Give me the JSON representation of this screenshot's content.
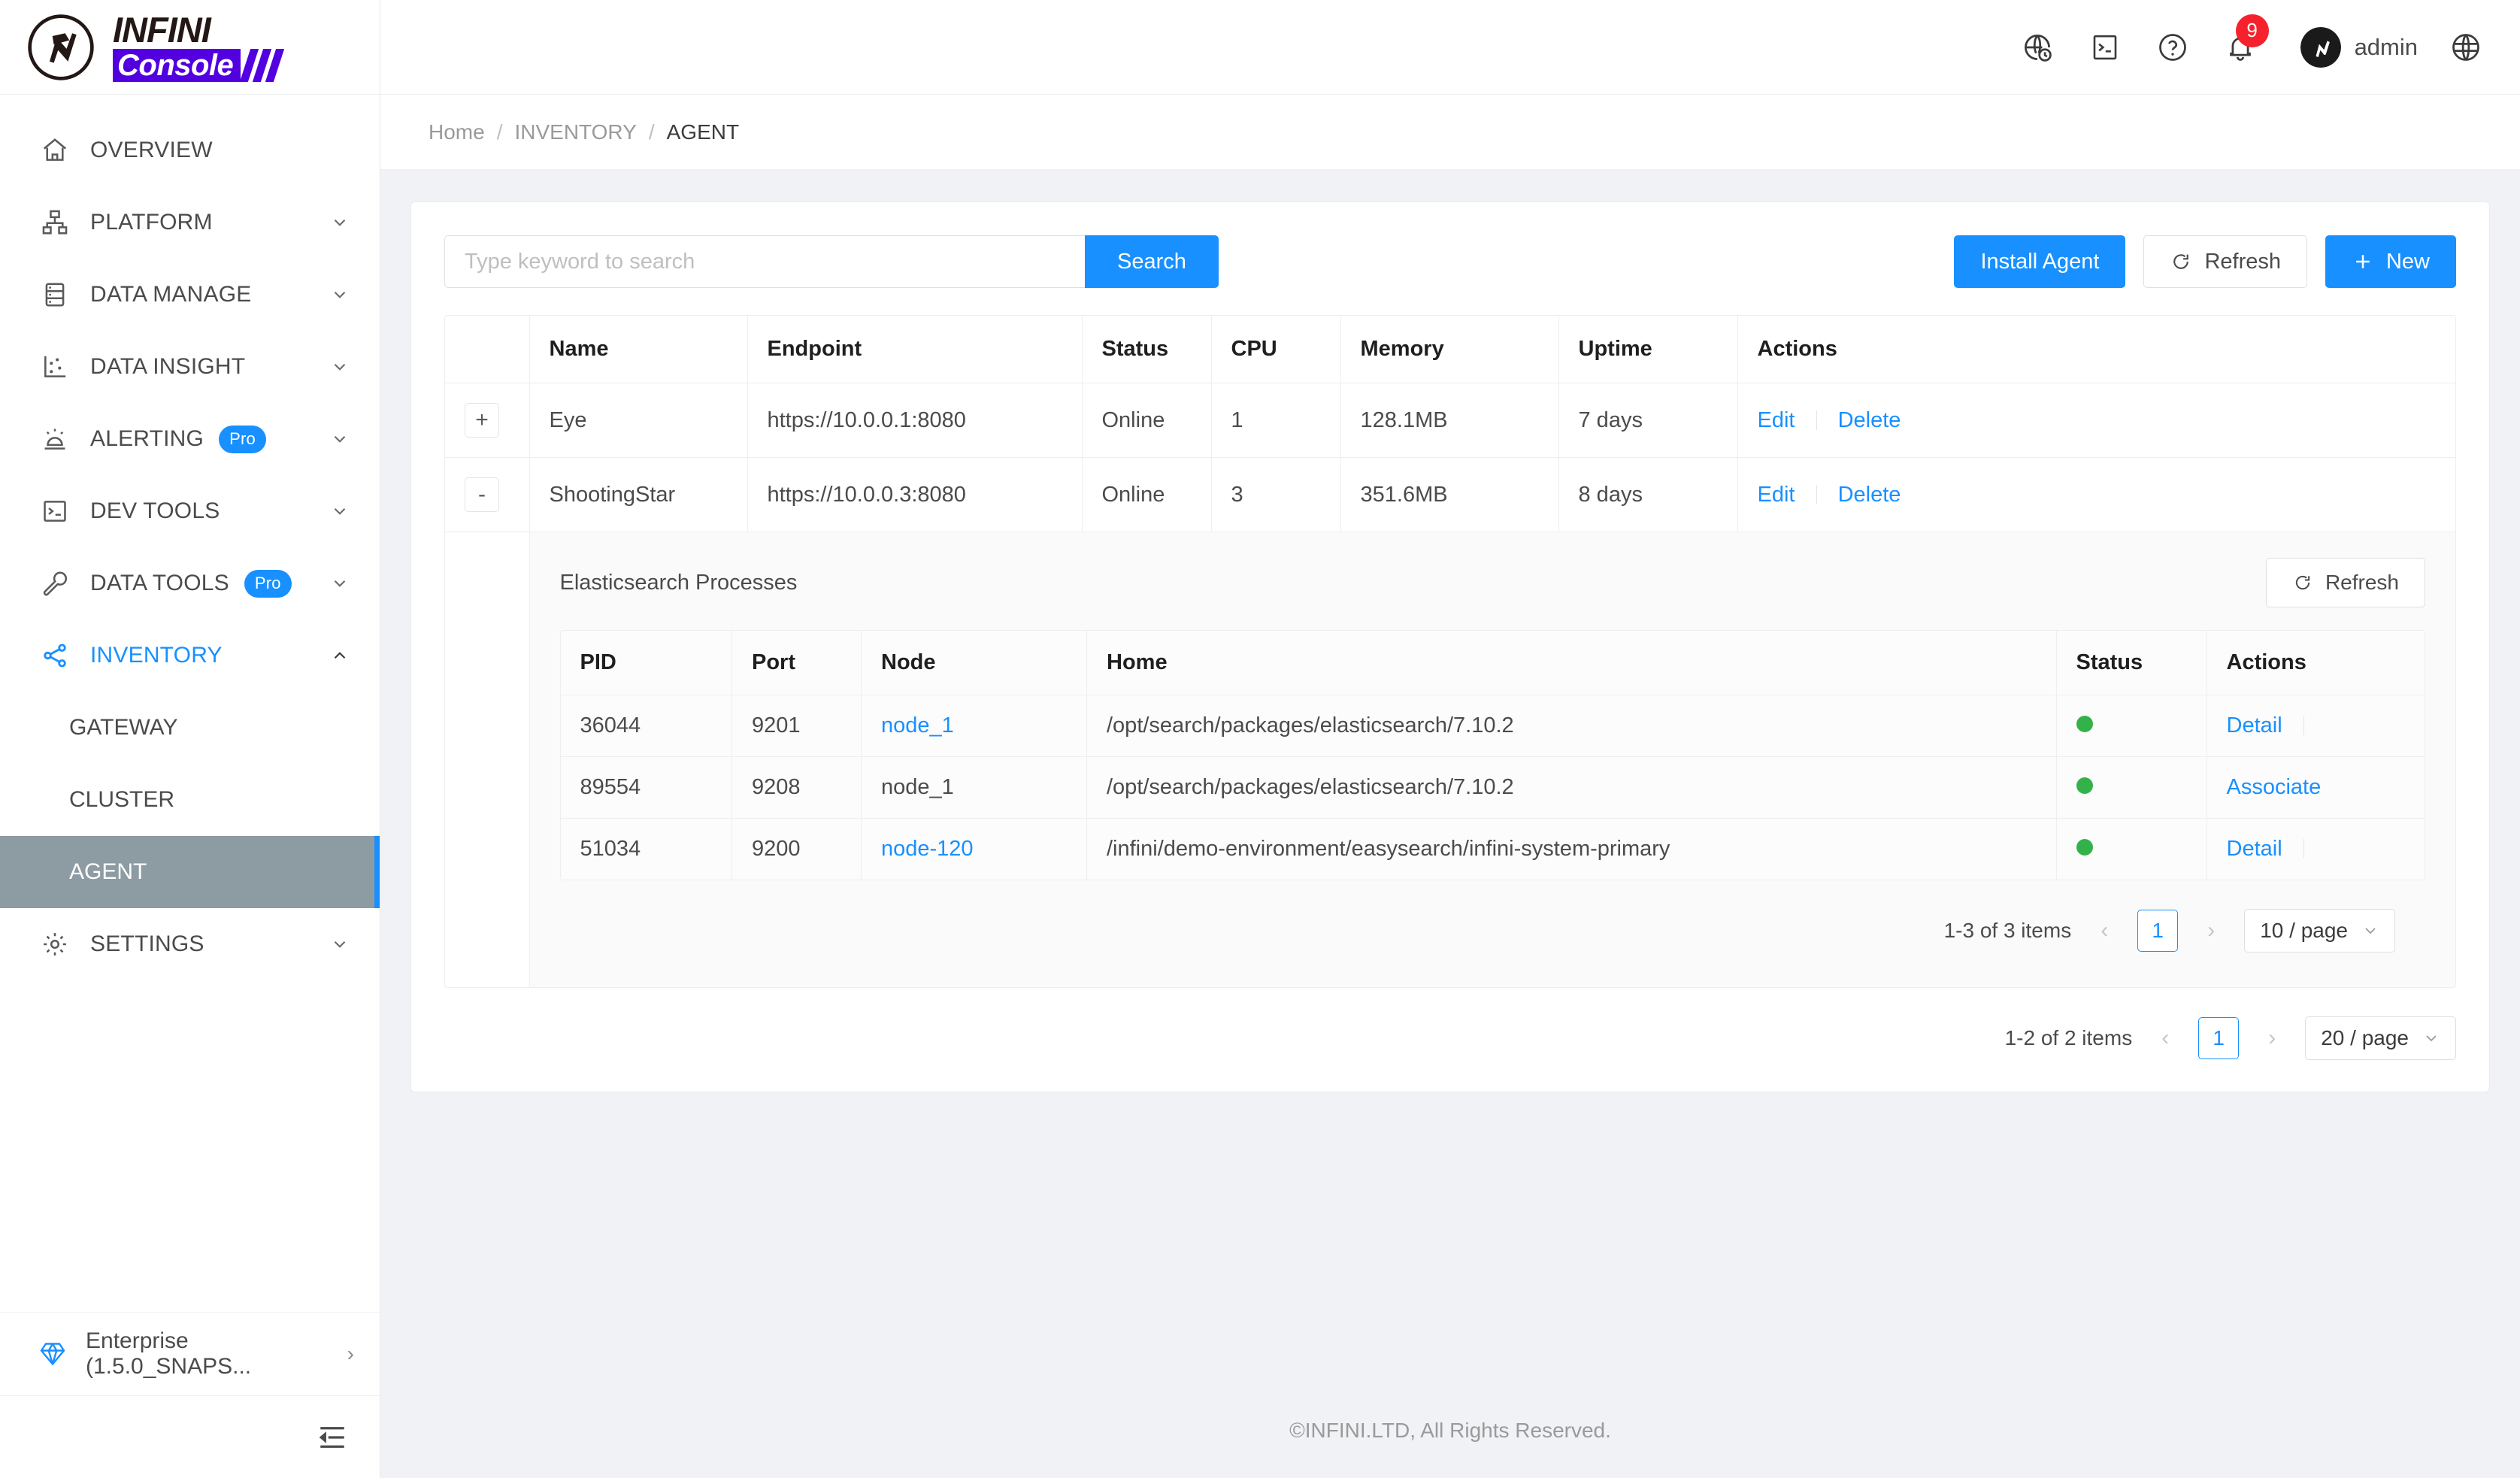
{
  "brand": {
    "line1": "INFINI",
    "line2": "Console"
  },
  "header": {
    "icons": [
      "globe-clock-icon",
      "console-icon",
      "help-icon",
      "bell-icon",
      "language-icon"
    ],
    "notification_count": "9",
    "user": "admin"
  },
  "breadcrumb": {
    "items": [
      "Home",
      "INVENTORY",
      "AGENT"
    ],
    "separator": "/"
  },
  "sidebar": {
    "items": [
      {
        "label": "OVERVIEW",
        "icon": "home-icon",
        "chevron": "",
        "badge": ""
      },
      {
        "label": "PLATFORM",
        "icon": "platform-icon",
        "chevron": "down",
        "badge": ""
      },
      {
        "label": "DATA MANAGE",
        "icon": "database-icon",
        "chevron": "down",
        "badge": ""
      },
      {
        "label": "DATA INSIGHT",
        "icon": "chart-icon",
        "chevron": "down",
        "badge": ""
      },
      {
        "label": "ALERTING",
        "icon": "alarm-icon",
        "chevron": "down",
        "badge": "Pro"
      },
      {
        "label": "DEV TOOLS",
        "icon": "terminal-icon",
        "chevron": "down",
        "badge": ""
      },
      {
        "label": "DATA TOOLS",
        "icon": "wrench-icon",
        "chevron": "down",
        "badge": "Pro"
      },
      {
        "label": "INVENTORY",
        "icon": "share-icon",
        "chevron": "up",
        "badge": ""
      }
    ],
    "inventory_children": [
      "GATEWAY",
      "CLUSTER",
      "AGENT"
    ],
    "selected_child": "AGENT",
    "settings": {
      "label": "SETTINGS",
      "icon": "gear-icon",
      "chevron": "down"
    },
    "license": {
      "label": "Enterprise (1.5.0_SNAPS...",
      "icon": "diamond-icon",
      "arrow": "›"
    },
    "collapse_icon": "collapse-menu-icon"
  },
  "toolbar": {
    "search_placeholder": "Type keyword to search",
    "search_value": "",
    "search_label": "Search",
    "install_agent_label": "Install Agent",
    "refresh_label": "Refresh",
    "new_label": "New",
    "new_icon": "plus-icon",
    "refresh_icon": "refresh-icon"
  },
  "agents_table": {
    "columns": [
      "",
      "Name",
      "Endpoint",
      "Status",
      "CPU",
      "Memory",
      "Uptime",
      "Actions"
    ],
    "rows": [
      {
        "expander": "+",
        "name": "Eye",
        "endpoint": "https://10.0.0.1:8080",
        "status": "Online",
        "cpu": "1",
        "memory": "128.1MB",
        "uptime": "7 days",
        "actions": [
          "Edit",
          "Delete"
        ]
      },
      {
        "expander": "-",
        "name": "ShootingStar",
        "endpoint": "https://10.0.0.3:8080",
        "status": "Online",
        "cpu": "3",
        "memory": "351.6MB",
        "uptime": "8 days",
        "actions": [
          "Edit",
          "Delete"
        ]
      }
    ],
    "pagination": {
      "info": "1-2 of 2 items",
      "prev": "‹",
      "page": "1",
      "next": "›",
      "page_size": "20 / page"
    }
  },
  "processes_panel": {
    "title": "Elasticsearch Processes",
    "refresh_label": "Refresh",
    "columns": [
      "PID",
      "Port",
      "Node",
      "Home",
      "Status",
      "Actions"
    ],
    "rows": [
      {
        "pid": "36044",
        "port": "9201",
        "node": "node_1",
        "node_is_link": true,
        "home": "/opt/search/packages/elasticsearch/7.10.2",
        "status": "green",
        "action": "Detail",
        "trailing_divider": true
      },
      {
        "pid": "89554",
        "port": "9208",
        "node": "node_1",
        "node_is_link": false,
        "home": "/opt/search/packages/elasticsearch/7.10.2",
        "status": "green",
        "action": "Associate",
        "trailing_divider": false
      },
      {
        "pid": "51034",
        "port": "9200",
        "node": "node-120",
        "node_is_link": true,
        "home": "/infini/demo-environment/easysearch/infini-system-primary",
        "status": "green",
        "action": "Detail",
        "trailing_divider": true
      }
    ],
    "pagination": {
      "info": "1-3 of 3 items",
      "prev": "‹",
      "page": "1",
      "next": "›",
      "page_size": "10 / page"
    }
  },
  "footer": {
    "text": "©INFINI.LTD, All Rights Reserved."
  },
  "colors": {
    "primary": "#1890ff",
    "brand_purple": "#5200e0",
    "online_green": "#13a10e",
    "status_dot_green": "#33b24a",
    "badge_red": "#f5222d",
    "selected_bg": "#8d9ba3"
  }
}
